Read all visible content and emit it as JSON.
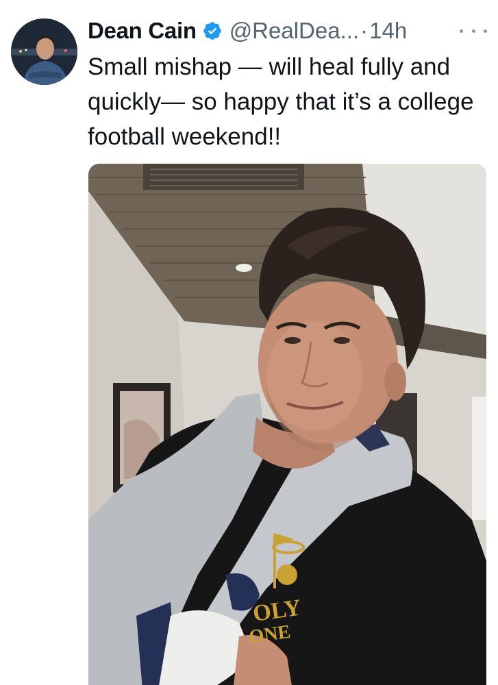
{
  "tweet": {
    "author": {
      "name": "Dean Cain",
      "handle": "@RealDea...",
      "verified": true,
      "avatar_icon": "profile-photo-avatar"
    },
    "separator": "·",
    "timestamp": "14h",
    "more_icon": "more-options-icon",
    "text": "Small mishap — will heal fully and quickly— so happy that it’s a college football weekend!!",
    "media": {
      "type": "photo",
      "shirt_text": [
        "OLY",
        "ONE"
      ]
    },
    "colors": {
      "name": "#0f1419",
      "meta": "#536471",
      "verified": "#1d9bf0"
    }
  }
}
